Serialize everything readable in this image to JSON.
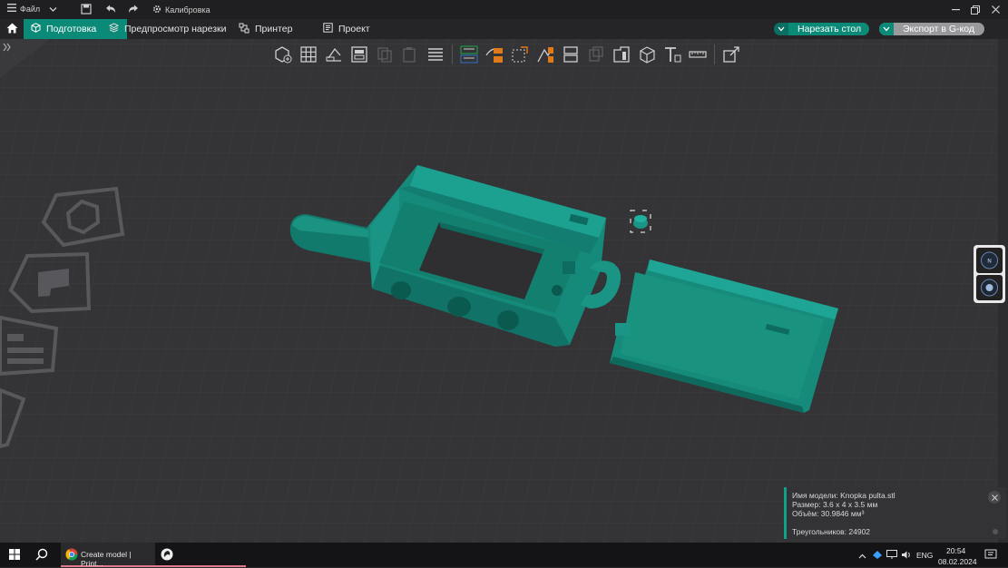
{
  "titlebar": {
    "file_menu": "Файл",
    "calibration": "Калибровка"
  },
  "tabs": {
    "prepare": "Подготовка",
    "preview": "Предпросмотр нарезки",
    "printer": "Принтер",
    "project": "Проект"
  },
  "actions": {
    "slice": "Нарезать стол",
    "export": "Экспорт в G-код"
  },
  "toolbar": {
    "icons": [
      "add-object-icon",
      "arrange-grid-icon",
      "auto-orient-icon",
      "layout-plate-icon",
      "copy-icon",
      "paste-icon",
      "layers-icon",
      "variable-height-icon",
      "rotate-numbers-icon",
      "scale-icon",
      "cut-icon",
      "split-icon",
      "text-icon",
      "measure-icon",
      "assembly-icon"
    ]
  },
  "info_panel": {
    "model_name": "Имя модели: Knopka pulta.stl",
    "size": "Размер: 3.6 x 4 x 3.5 мм",
    "volume": "Объём: 30.9846 мм³",
    "triangles": "Треугольников: 24902"
  },
  "taskbar": {
    "chrome_task": "Create model | Print...",
    "lang": "ENG",
    "time": "20:54",
    "date": "08.02.2024"
  },
  "colors": {
    "accent": "#0c8a78",
    "model": "#17897a",
    "background": "#2e2e30"
  }
}
